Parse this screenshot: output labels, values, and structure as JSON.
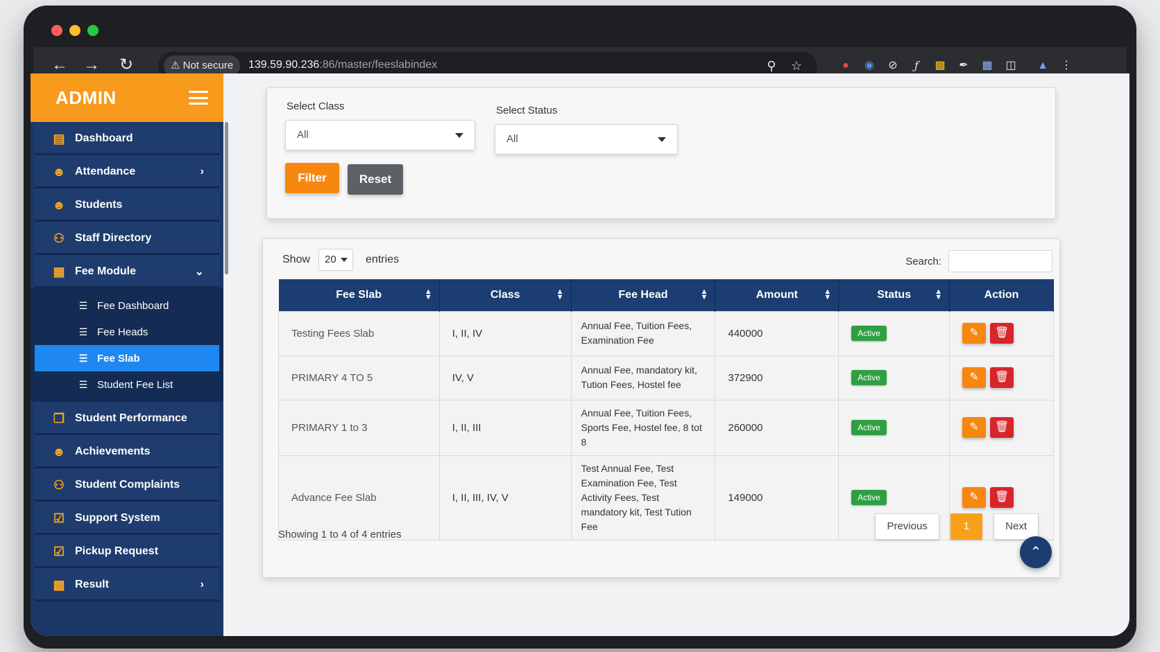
{
  "browser": {
    "security_label": "Not secure",
    "url_host": "139.59.90.236",
    "url_path": ":86/master/feeslabindex",
    "nav_icons": [
      "back-arrow-icon",
      "forward-arrow-icon",
      "reload-icon"
    ],
    "omnibox_icons": [
      "zoom-icon",
      "bookmark-star-icon"
    ],
    "extension_icons": [
      "extension-red-icon",
      "extension-lens-icon",
      "extension-compass-icon",
      "extension-fx-icon",
      "extension-chart-icon",
      "extension-eyedropper-icon",
      "extension-docs-icon",
      "extensions-puzzle-icon",
      "profile-avatar-icon",
      "menu-kebab-icon"
    ]
  },
  "sidebar": {
    "brand": "ADMIN",
    "items": [
      {
        "label": "Dashboard",
        "icon": "dashboard-icon"
      },
      {
        "label": "Attendance",
        "icon": "user-icon",
        "chevron": "right"
      },
      {
        "label": "Students",
        "icon": "user-icon"
      },
      {
        "label": "Staff Directory",
        "icon": "users-group-icon"
      },
      {
        "label": "Fee Module",
        "icon": "calendar-icon",
        "chevron": "down"
      }
    ],
    "fee_submenu": [
      {
        "label": "Fee Dashboard"
      },
      {
        "label": "Fee Heads"
      },
      {
        "label": "Fee Slab",
        "active": true
      },
      {
        "label": "Student Fee List"
      }
    ],
    "items_after": [
      {
        "label": "Student Performance",
        "icon": "copy-icon"
      },
      {
        "label": "Achievements",
        "icon": "user-icon"
      },
      {
        "label": "Student Complaints",
        "icon": "users-group-icon"
      },
      {
        "label": "Support System",
        "icon": "calendar-check-icon"
      },
      {
        "label": "Pickup Request",
        "icon": "calendar-check-icon"
      },
      {
        "label": "Result",
        "icon": "report-icon",
        "chevron": "right"
      }
    ]
  },
  "filter": {
    "class_label": "Select Class",
    "class_value": "All",
    "status_label": "Select Status",
    "status_value": "All",
    "filter_button": "Filter",
    "reset_button": "Reset"
  },
  "table": {
    "show_label": "Show",
    "page_length": "20",
    "entries_label": "entries",
    "search_label": "Search:",
    "columns": [
      "Fee Slab",
      "Class",
      "Fee Head",
      "Amount",
      "Status",
      "Action"
    ],
    "rows": [
      {
        "fee_slab": "Testing Fees Slab",
        "class": "I, II, IV",
        "fee_head": "Annual Fee, Tuition Fees, Examination Fee",
        "amount": "440000",
        "status": "Active"
      },
      {
        "fee_slab": "PRIMARY 4 TO 5",
        "class": "IV, V",
        "fee_head": "Annual Fee, mandatory kit, Tution Fees, Hostel fee",
        "amount": "372900",
        "status": "Active"
      },
      {
        "fee_slab": "PRIMARY 1 to 3",
        "class": "I, II, III",
        "fee_head": "Annual Fee, Tuition Fees, Sports Fee, Hostel fee, 8 tot 8",
        "amount": "260000",
        "status": "Active"
      },
      {
        "fee_slab": "Advance Fee Slab",
        "class": "I, II, III, IV, V",
        "fee_head": "Test Annual Fee, Test Examination Fee, Test Activity Fees, Test mandatory kit, Test Tution Fee",
        "amount": "149000",
        "status": "Active"
      }
    ],
    "info": "Showing 1 to 4 of 4 entries",
    "pagination": {
      "previous": "Previous",
      "current": "1",
      "next": "Next"
    }
  },
  "colors": {
    "brand_orange": "#f89a1c",
    "sidebar_navy": "#1b3765",
    "active_blue": "#1e88f0",
    "status_green": "#2ea043",
    "delete_red": "#d7262b"
  }
}
